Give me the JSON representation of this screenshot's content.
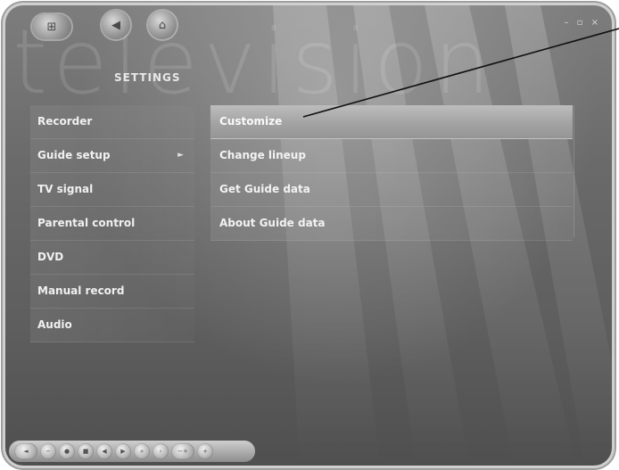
{
  "window": {
    "background_word": "television",
    "section_title": "SETTINGS",
    "window_controls": "– ▫ ×"
  },
  "left_menu": {
    "items": [
      {
        "label": "Recorder"
      },
      {
        "label": "Guide setup",
        "expanded_marker": "►"
      },
      {
        "label": "TV signal"
      },
      {
        "label": "Parental control"
      },
      {
        "label": "DVD"
      },
      {
        "label": "Manual record"
      },
      {
        "label": "Audio"
      }
    ]
  },
  "right_menu": {
    "items": [
      {
        "label": "Customize",
        "selected": true
      },
      {
        "label": "Change lineup"
      },
      {
        "label": "Get Guide data"
      },
      {
        "label": "About Guide data"
      }
    ]
  },
  "colors": {
    "background": "#6a6a6a",
    "selected_item": "#a3a3a3",
    "text": "#f0f0f0"
  },
  "top_buttons": [
    {
      "icon": "media-center-logo-icon"
    },
    {
      "icon": "back-icon"
    },
    {
      "icon": "home-icon"
    }
  ],
  "transport_controls": [
    {
      "icon": "mute-icon"
    },
    {
      "icon": "volume-down-icon"
    },
    {
      "icon": "record-icon"
    },
    {
      "icon": "stop-icon"
    },
    {
      "icon": "rewind-icon"
    },
    {
      "icon": "play-icon"
    },
    {
      "icon": "fast-forward-icon"
    },
    {
      "icon": "skip-icon"
    },
    {
      "icon": "channel-icon"
    },
    {
      "icon": "volume-up-icon"
    }
  ]
}
